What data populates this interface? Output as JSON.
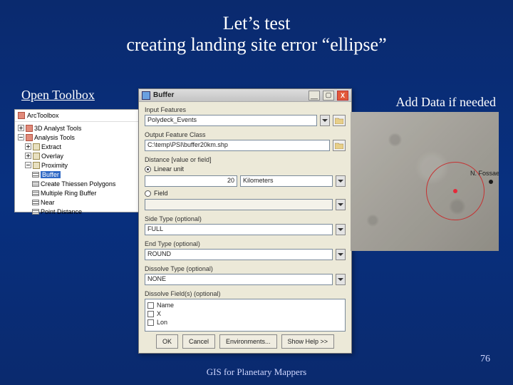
{
  "slide": {
    "title_line1": "Let’s test",
    "title_line2": "creating landing site error “ellipse”",
    "label_left": "Open Toolbox",
    "label_right": "Add Data if needed",
    "footer": "GIS for Planetary Mappers",
    "page_number": "76"
  },
  "toolbox": {
    "root": "ArcToolbox",
    "items": [
      "3D Analyst Tools",
      "Analysis Tools"
    ],
    "analysis_children": [
      "Extract",
      "Overlay",
      "Proximity"
    ],
    "proximity_tools": [
      "Buffer",
      "Create Thiessen Polygons",
      "Multiple Ring Buffer",
      "Near",
      "Point Distance"
    ],
    "selected": "Buffer"
  },
  "dialog": {
    "title": "Buffer",
    "fields": {
      "input_features": {
        "label": "Input Features",
        "value": "Polydeck_Events"
      },
      "output": {
        "label": "Output Feature Class",
        "value": "C:\\temp\\PSI\\buffer20km.shp"
      },
      "distance": {
        "label": "Distance [value or field]",
        "radio": "Linear unit",
        "value": "20",
        "unit": "Kilometers",
        "radio2": "Field"
      },
      "side_type": {
        "label": "Side Type (optional)",
        "value": "FULL"
      },
      "end_type": {
        "label": "End Type (optional)",
        "value": "ROUND"
      },
      "dissolve_type": {
        "label": "Dissolve Type (optional)",
        "value": "NONE"
      },
      "dissolve_fields": {
        "label": "Dissolve Field(s) (optional)",
        "options": [
          "Name",
          "X",
          "Lon"
        ]
      }
    },
    "buttons": {
      "ok": "OK",
      "cancel": "Cancel",
      "env": "Environments...",
      "help": "Show Help >>"
    }
  },
  "map": {
    "point_label": "N. Fossae"
  }
}
